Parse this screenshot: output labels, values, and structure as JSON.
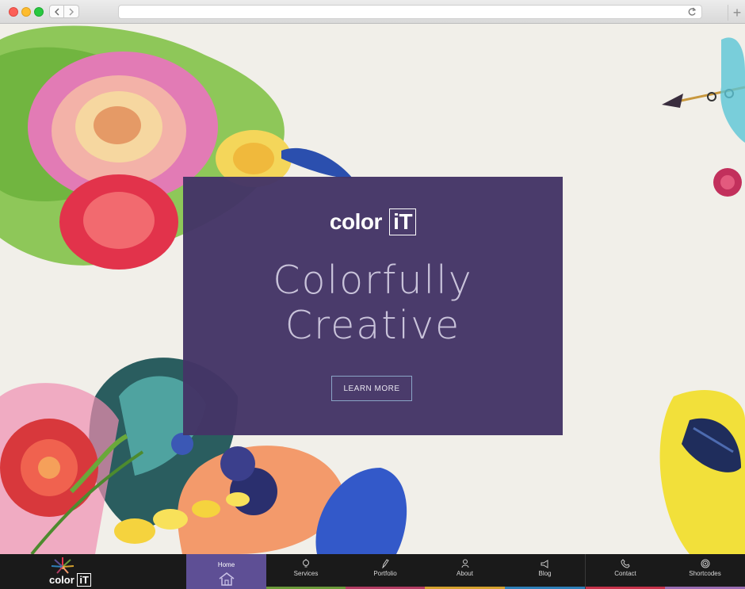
{
  "hero": {
    "brand_word": "color",
    "brand_box": "iT",
    "headline_line1": "Colorfully",
    "headline_line2": "Creative",
    "cta_label": "LEARN MORE"
  },
  "footer_brand": {
    "word": "color",
    "box": "iT"
  },
  "nav": {
    "items": [
      {
        "label": "Home",
        "icon": "home-icon",
        "accent": "#5e4f95"
      },
      {
        "label": "Services",
        "icon": "lightbulb-icon",
        "accent": "#6a9a3a"
      },
      {
        "label": "Portfolio",
        "icon": "pen-icon",
        "accent": "#b33b63"
      },
      {
        "label": "About",
        "icon": "person-icon",
        "accent": "#d4a12e"
      },
      {
        "label": "Blog",
        "icon": "megaphone-icon",
        "accent": "#2e7fb8"
      },
      {
        "label": "Contact",
        "icon": "phone-icon",
        "accent": "#c7324a"
      },
      {
        "label": "Shortcodes",
        "icon": "target-icon",
        "accent": "#9a6cb3"
      }
    ]
  },
  "colors": {
    "panel": "#443566",
    "nav_bg": "#1a1a1a",
    "active": "#5e4f95"
  }
}
